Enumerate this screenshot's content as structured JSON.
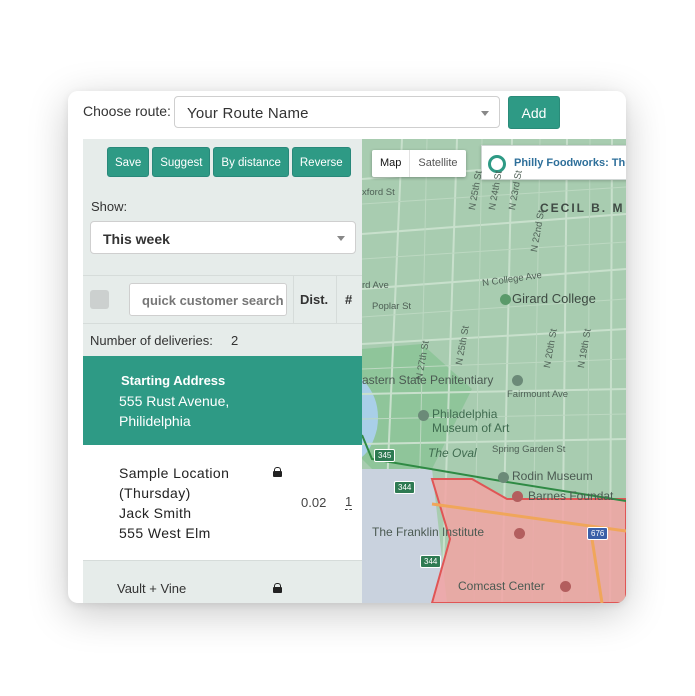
{
  "header": {
    "choose_label": "Choose route:",
    "route_value": "Your Route Name",
    "add_label": "Add"
  },
  "toolbar": {
    "buttons": [
      "Save",
      "Suggest",
      "By distance",
      "Reverse"
    ]
  },
  "filter": {
    "show_label": "Show:",
    "week_value": "This week"
  },
  "table": {
    "search_placeholder": "quick customer search",
    "col_dist": "Dist.",
    "col_num": "#",
    "deliveries_label": "Number of deliveries:",
    "deliveries_count": "2"
  },
  "start": {
    "title": "Starting Address",
    "address": "555 Rust Avenue, Philidelphia"
  },
  "stops": [
    {
      "lines": [
        "Sample Location",
        "(Thursday)",
        "Jack Smith",
        "555 West Elm"
      ],
      "dist": "0.02",
      "order": "1"
    },
    {
      "lines": [
        "Vault + Vine"
      ]
    }
  ],
  "map": {
    "type_options": [
      "Map",
      "Satellite"
    ],
    "popup_text": "Philly Foodworks: Thu",
    "labels": {
      "cecil": "CECIL B. M",
      "n25": "N 25th St",
      "n24": "N 24th St",
      "n23": "N 23rd St",
      "n22": "N 22nd St",
      "nwkford": "xford St",
      "college_ave": "N College Ave",
      "girard_college": "Girard College",
      "poplar": "Poplar St",
      "rd_ave": "rd Ave",
      "n27": "N 27th St",
      "n25b": "N 25th St",
      "n20": "N 20th St",
      "n19": "N 19th St",
      "penitentiary": "astern State Penitentiary",
      "fairmount": "Fairmount Ave",
      "museum": "Philadelphia Museum of Art",
      "spring_garden": "Spring Garden St",
      "oval": "The Oval",
      "rodin": "Rodin Museum",
      "barnes": "Barnes Foundat",
      "franklin": "The Franklin Institute",
      "comcast": "Comcast Center"
    },
    "shields": [
      "345",
      "344",
      "344",
      "676"
    ],
    "colors": {
      "land": "#a8ccb0",
      "zone_fill": "#f2a3a3",
      "zone_stroke": "#e05555",
      "route_stroke": "#2f8a44",
      "accent": "#2e9a85"
    }
  }
}
